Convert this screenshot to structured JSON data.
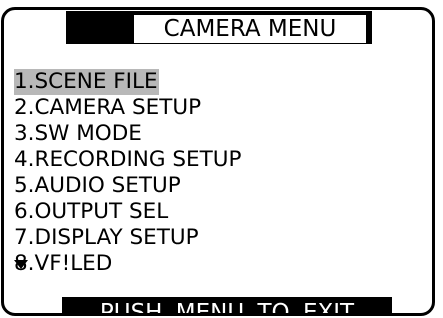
{
  "header": {
    "title": "CAMERA MENU"
  },
  "menu": {
    "items": [
      {
        "label": "1.SCENE FILE",
        "selected": true
      },
      {
        "label": "2.CAMERA SETUP",
        "selected": false
      },
      {
        "label": "3.SW MODE",
        "selected": false
      },
      {
        "label": "4.RECORDING SETUP",
        "selected": false
      },
      {
        "label": "5.AUDIO SETUP",
        "selected": false
      },
      {
        "label": "6.OUTPUT SEL",
        "selected": false
      },
      {
        "label": "7.DISPLAY SETUP",
        "selected": false
      },
      {
        "label": "8.VF!LED",
        "selected": false
      }
    ],
    "more_indicator_icon": "triangle-down-icon"
  },
  "footer": {
    "hint": "PUSH MENU TO EXIT"
  },
  "colors": {
    "background": "#ffffff",
    "text": "#000000",
    "bar": "#000000",
    "selection": "#b8b8b8"
  }
}
